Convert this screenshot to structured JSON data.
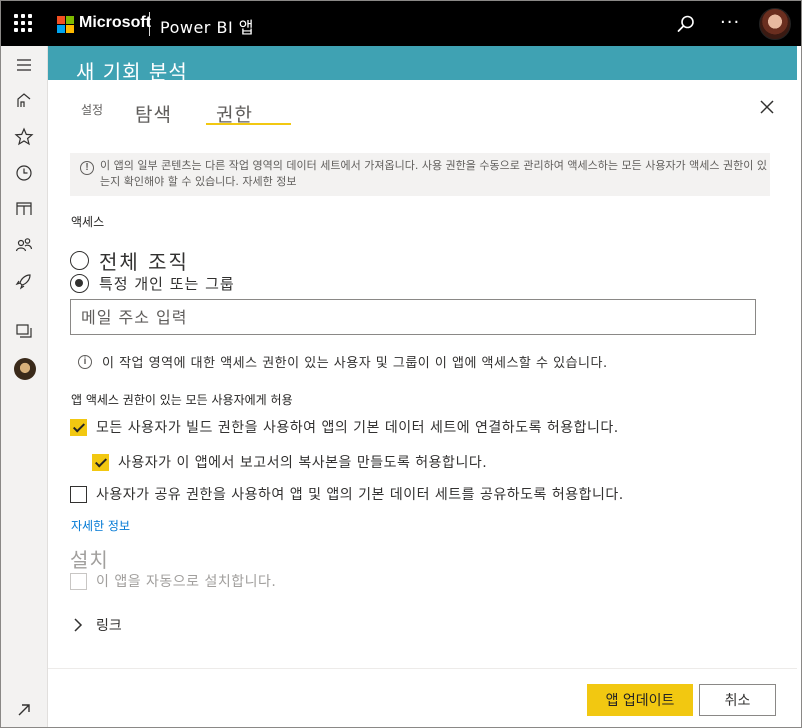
{
  "topbar": {
    "brand": "Microsoft",
    "app_name": "Power BI 앱",
    "more_label": "···"
  },
  "rail": {
    "icons": [
      "menu-icon",
      "home-icon",
      "star-icon",
      "clock-icon",
      "apps-icon",
      "shared-icon",
      "rocket-icon",
      "workspaces-icon",
      "workspace-avatar",
      "expand-icon"
    ]
  },
  "banner": {
    "title": "새 기회 분석"
  },
  "tabs": {
    "setup": "설정",
    "navigation": "탐색",
    "permissions": "권한"
  },
  "info_box": {
    "text": "이 앱의 일부 콘텐츠는 다른 작업 영역의 데이터 세트에서 가져옵니다. 사용 권한을 수동으로 관리하여 액세스하는 모든 사용자가 액세스 권한이 있는지 확인해야 할 수 있습니다. 자세한 정보"
  },
  "access": {
    "label": "액세스",
    "option_org": "전체 조직",
    "option_specific": "특정 개인 또는 그룹",
    "selected": "option_specific",
    "email_placeholder": "메일 주소 입력",
    "note": "이 작업 영역에 대한 액세스 권한이 있는 사용자 및 그룹이 이 앱에 액세스할 수 있습니다."
  },
  "allow": {
    "label": "앱 액세스 권한이 있는 모든 사용자에게 허용",
    "build": {
      "label": "모든 사용자가 빌드 권한을 사용하여 앱의 기본 데이터 세트에 연결하도록 허용합니다.",
      "checked": true
    },
    "copy": {
      "label": "사용자가 이 앱에서 보고서의 복사본을 만들도록 허용합니다.",
      "checked": true
    },
    "share": {
      "label": "사용자가 공유 권한을 사용하여 앱 및 앱의 기본 데이터 세트를 공유하도록 허용합니다.",
      "checked": false
    },
    "learn_more": "자세한 정보"
  },
  "install": {
    "title": "설치",
    "auto_install": "이 앱을 자동으로 설치합니다.",
    "checked": false
  },
  "links": {
    "label": "링크"
  },
  "footer": {
    "update_label": "앱 업데이트",
    "cancel_label": "취소"
  },
  "colors": {
    "accent": "#f2c811",
    "banner": "#3fa2b3",
    "link": "#0078d4"
  }
}
